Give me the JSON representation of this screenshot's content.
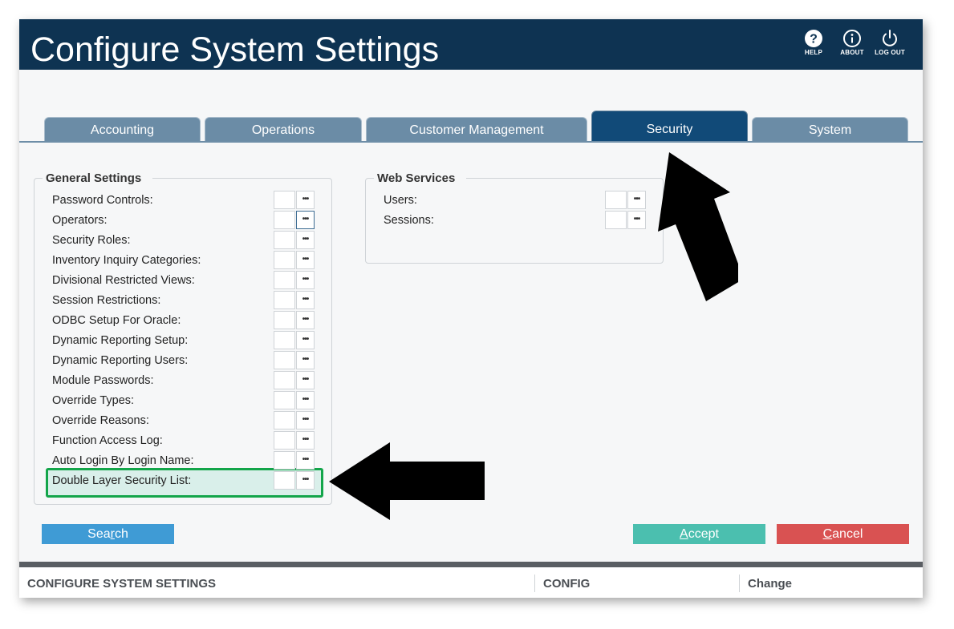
{
  "app": {
    "title": "Configure System Settings"
  },
  "toolbar": {
    "help_label": "HELP",
    "about_label": "ABOUT",
    "logout_label": "LOG OUT"
  },
  "tabs": [
    {
      "label": "Accounting",
      "active": false
    },
    {
      "label": "Operations",
      "active": false
    },
    {
      "label": "Customer Management",
      "active": false
    },
    {
      "label": "Security",
      "active": true
    },
    {
      "label": "System",
      "active": false
    }
  ],
  "general_settings": {
    "legend": "General Settings",
    "items": [
      {
        "label": "Password Controls:"
      },
      {
        "label": "Operators:"
      },
      {
        "label": "Security Roles:"
      },
      {
        "label": "Inventory Inquiry Categories:"
      },
      {
        "label": "Divisional Restricted Views:"
      },
      {
        "label": "Session Restrictions:"
      },
      {
        "label": "ODBC Setup For Oracle:"
      },
      {
        "label": "Dynamic Reporting Setup:"
      },
      {
        "label": "Dynamic Reporting Users:"
      },
      {
        "label": "Module Passwords:"
      },
      {
        "label": "Override Types:"
      },
      {
        "label": "Override Reasons:"
      },
      {
        "label": "Function Access Log:"
      },
      {
        "label": "Auto Login By Login Name:"
      },
      {
        "label": "Double Layer Security List:"
      }
    ],
    "ellipsis": "•••"
  },
  "web_services": {
    "legend": "Web Services",
    "items": [
      {
        "label": "Users:"
      },
      {
        "label": "Sessions:"
      }
    ],
    "ellipsis": "•••"
  },
  "buttons": {
    "search": {
      "pre": "Sea",
      "key": "r",
      "post": "ch"
    },
    "accept": {
      "pre": "",
      "key": "A",
      "post": "ccept"
    },
    "cancel": {
      "pre": "",
      "key": "C",
      "post": "ancel"
    }
  },
  "statusbar": {
    "screen": "CONFIGURE SYSTEM SETTINGS",
    "module": "CONFIG",
    "mode": "Change"
  },
  "colors": {
    "titlebar": "#0e3352",
    "tab": "#6b8ca6",
    "tab_active": "#114a78",
    "search": "#3f9bd5",
    "accept": "#4bbfaf",
    "cancel": "#d95252",
    "highlight_border": "#13a54a"
  }
}
